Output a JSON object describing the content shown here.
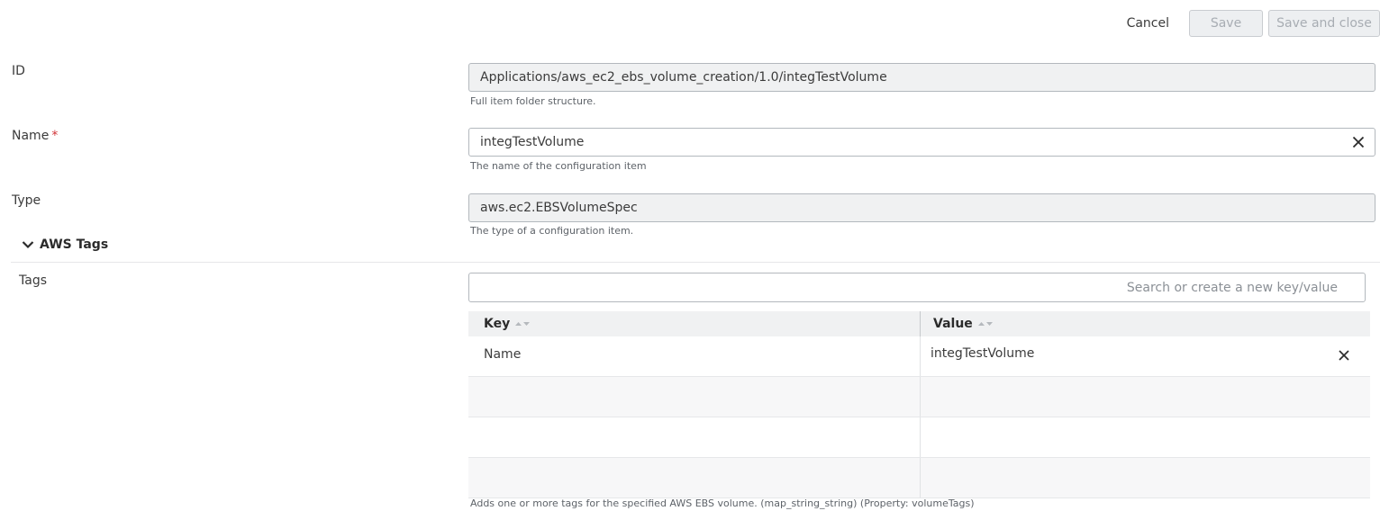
{
  "actions": {
    "cancel_label": "Cancel",
    "save_label": "Save",
    "save_close_label": "Save and close"
  },
  "fields": {
    "id": {
      "label": "ID",
      "value": "Applications/aws_ec2_ebs_volume_creation/1.0/integTestVolume",
      "helper": "Full item folder structure."
    },
    "name": {
      "label": "Name",
      "required_mark": "*",
      "value": "integTestVolume",
      "helper": "The name of the configuration item"
    },
    "type": {
      "label": "Type",
      "value": "aws.ec2.EBSVolumeSpec",
      "helper": "The type of a configuration item."
    }
  },
  "section": {
    "title": "AWS Tags"
  },
  "tags": {
    "label": "Tags",
    "search_placeholder": "Search or create a new key/value",
    "columns": [
      "Key",
      "Value"
    ],
    "rows": [
      {
        "key": "Name",
        "value": "integTestVolume"
      }
    ],
    "helper": "Adds one or more tags for the specified AWS EBS volume. (map_string_string) (Property: volumeTags)"
  }
}
